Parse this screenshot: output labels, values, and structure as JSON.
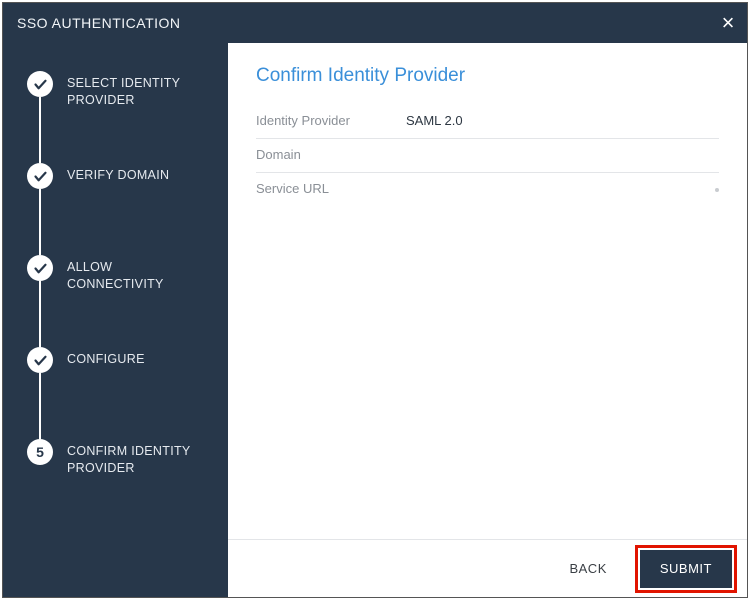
{
  "dialog": {
    "title": "SSO AUTHENTICATION"
  },
  "sidebar": {
    "steps": [
      {
        "label": "SELECT IDENTITY PROVIDER",
        "state": "done"
      },
      {
        "label": "VERIFY DOMAIN",
        "state": "done"
      },
      {
        "label": "ALLOW CONNECTIVITY",
        "state": "done"
      },
      {
        "label": "CONFIGURE",
        "state": "done"
      },
      {
        "label": "CONFIRM IDENTITY PROVIDER",
        "state": "current",
        "number": "5"
      }
    ]
  },
  "main": {
    "heading": "Confirm Identity Provider",
    "fields": {
      "identity_provider_label": "Identity Provider",
      "identity_provider_value": "SAML 2.0",
      "domain_label": "Domain",
      "domain_value": "",
      "service_url_label": "Service URL",
      "service_url_value": ""
    }
  },
  "footer": {
    "back_label": "BACK",
    "submit_label": "SUBMIT"
  }
}
